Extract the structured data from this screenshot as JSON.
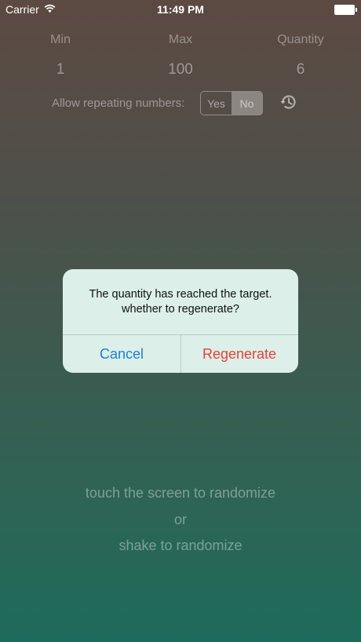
{
  "status_bar": {
    "carrier": "Carrier",
    "time": "11:49 PM"
  },
  "settings": {
    "min_label": "Min",
    "max_label": "Max",
    "quantity_label": "Quantity",
    "min_value": "1",
    "max_value": "100",
    "quantity_value": "6",
    "repeat_label": "Allow repeating numbers:",
    "repeat_options": [
      "Yes",
      "No"
    ],
    "repeat_selected": "No",
    "history_icon": "history-icon"
  },
  "alert": {
    "message_line1": "The quantity has reached the target.",
    "message_line2": "whether to regenerate?",
    "cancel_label": "Cancel",
    "regenerate_label": "Regenerate",
    "cancel_color": "#1e7fd6",
    "regenerate_color": "#e4413a"
  },
  "hints": {
    "line1": "touch the screen to randomize",
    "line2": "or",
    "line3": "shake to randomize"
  }
}
